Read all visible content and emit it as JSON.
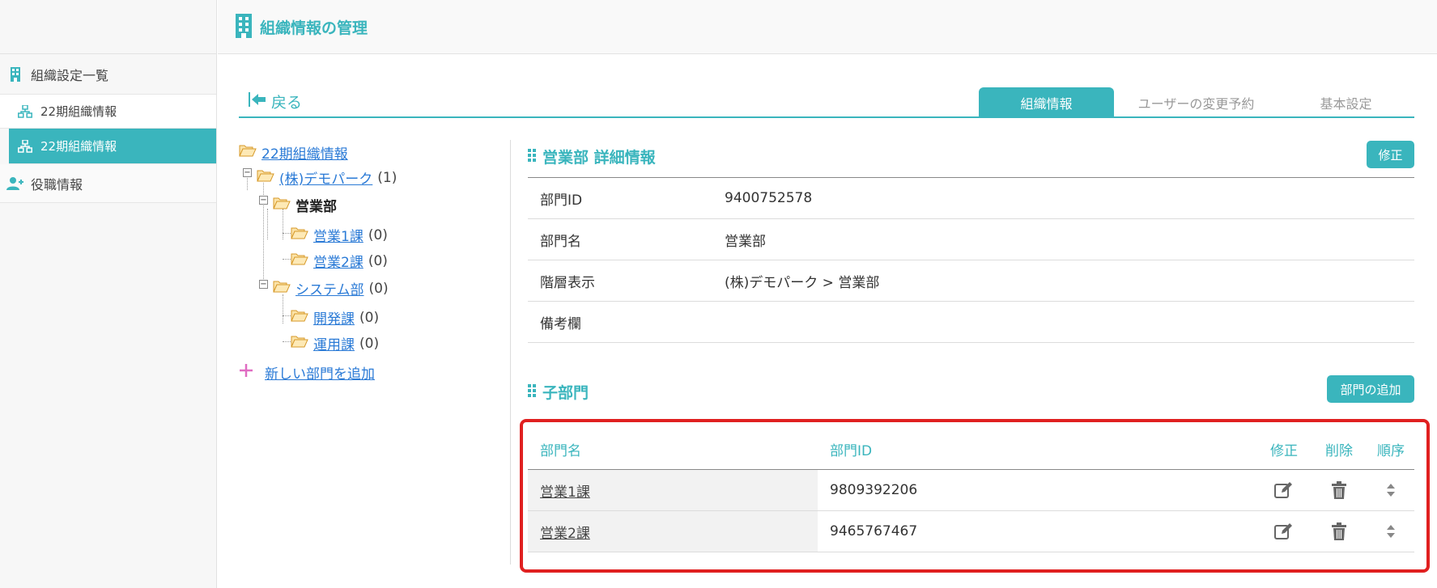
{
  "sidebar": {
    "header_label": "組織設定一覧",
    "items": [
      {
        "label": "22期組織情報"
      },
      {
        "label": "22期組織情報"
      },
      {
        "label": "役職情報"
      }
    ]
  },
  "header": {
    "title": "組織情報の管理"
  },
  "nav": {
    "back_label": "戻る",
    "tabs": [
      {
        "label": "組織情報"
      },
      {
        "label": "ユーザーの変更予約"
      },
      {
        "label": "基本設定"
      }
    ]
  },
  "tree": {
    "root": "22期組織情報",
    "company": {
      "label": "(株)デモパーク",
      "count": "(1)"
    },
    "dept_sales": {
      "label": "営業部"
    },
    "sales1": {
      "label": "営業1課",
      "count": "(0)"
    },
    "sales2": {
      "label": "営業2課",
      "count": "(0)"
    },
    "dept_system": {
      "label": "システム部",
      "count": "(0)"
    },
    "dev": {
      "label": "開発課",
      "count": "(0)"
    },
    "ops": {
      "label": "運用課",
      "count": "(0)"
    },
    "add_label": "新しい部門を追加"
  },
  "detail": {
    "title": "営業部 詳細情報",
    "edit_label": "修正",
    "rows": [
      {
        "key": "部門ID",
        "value": "9400752578"
      },
      {
        "key": "部門名",
        "value": "営業部"
      },
      {
        "key": "階層表示",
        "value": "(株)デモパーク > 営業部"
      },
      {
        "key": "備考欄",
        "value": ""
      }
    ]
  },
  "children": {
    "title": "子部門",
    "add_label": "部門の追加",
    "columns": {
      "name": "部門名",
      "id": "部門ID",
      "edit": "修正",
      "delete": "削除",
      "order": "順序"
    },
    "rows": [
      {
        "name": "営業1課",
        "id": "9809392206"
      },
      {
        "name": "営業2課",
        "id": "9465767467"
      }
    ]
  },
  "colors": {
    "accent": "#3ab5bd",
    "link": "#2a7ad6",
    "highlight": "#e02020"
  }
}
